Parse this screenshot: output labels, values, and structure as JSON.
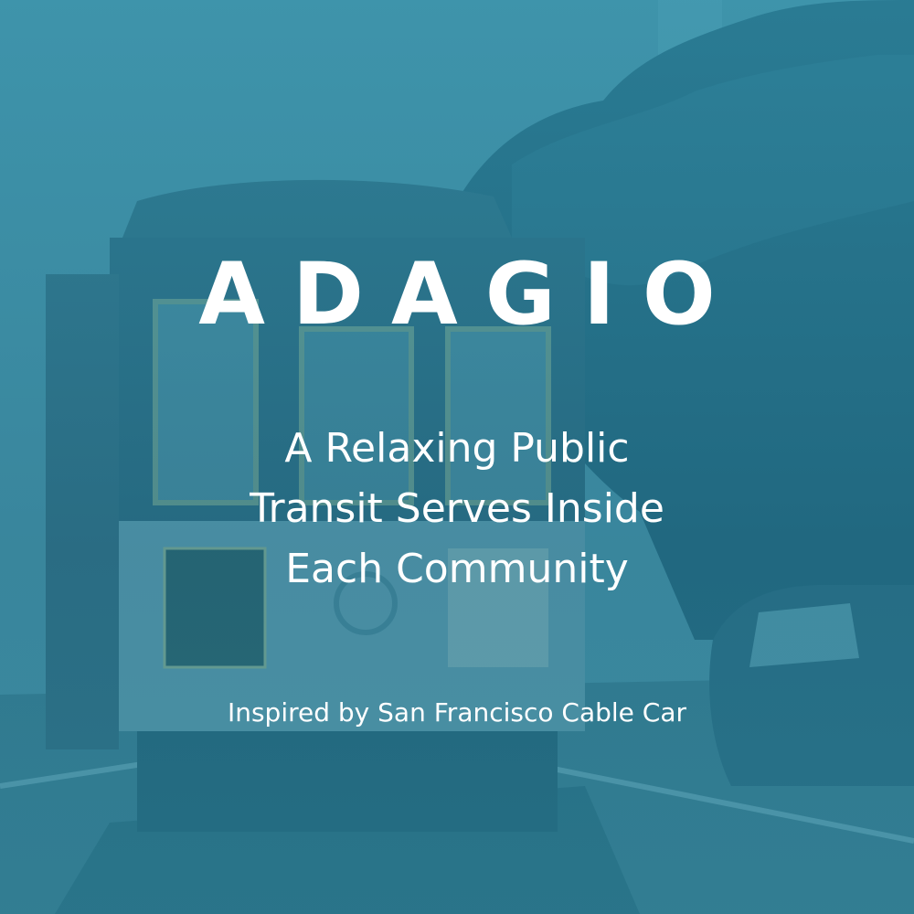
{
  "brand": {
    "name": "ADAGIO"
  },
  "tagline": {
    "lines": [
      "A Relaxing Public",
      "Transit Serves Inside",
      "Each Community"
    ]
  },
  "caption": {
    "text": "Inspired by San Francisco Cable Car"
  },
  "background": {
    "subject": "cable-car-street-photo",
    "tint_color": "#3f8ea3"
  }
}
